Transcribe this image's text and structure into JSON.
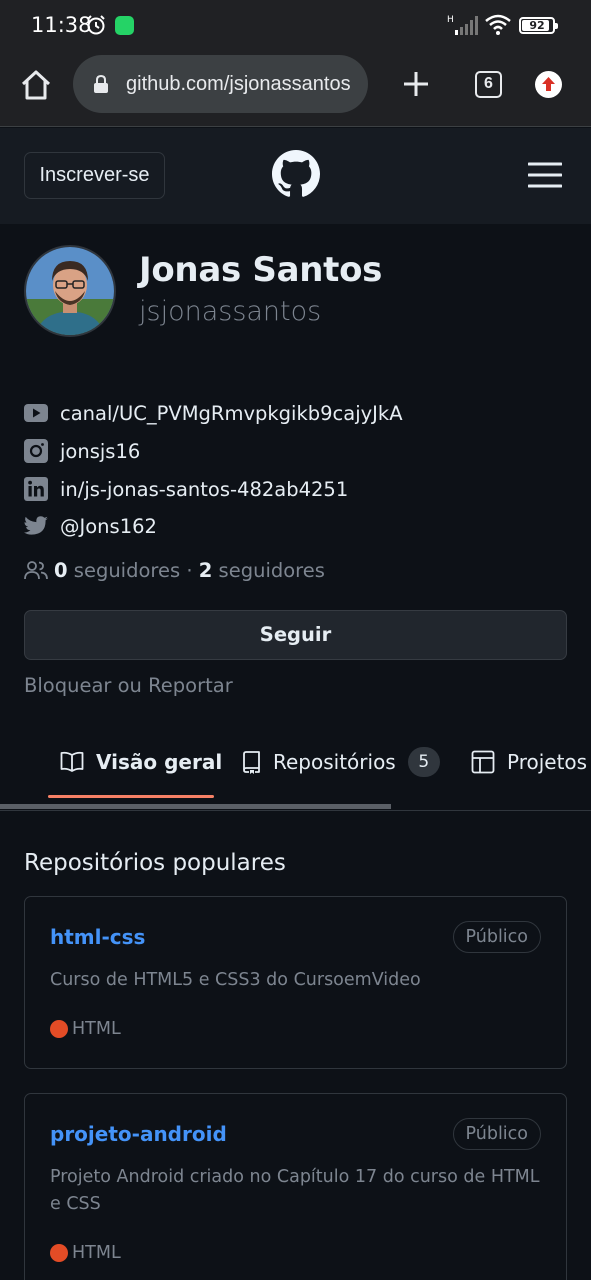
{
  "status_bar": {
    "time": "11:38",
    "network_label": "H",
    "battery_level": "92",
    "battery_fraction": 0.92
  },
  "browser": {
    "url": "github.com/jsjonassantos",
    "tab_count": "6",
    "icons": [
      "home-icon",
      "lock-icon",
      "plus-icon",
      "tabs-icon",
      "update-icon"
    ]
  },
  "header": {
    "signup_label": "Inscrever-se",
    "logo": "github-icon",
    "menu_icon": "hamburger-menu-icon"
  },
  "profile": {
    "display_name": "Jonas Santos",
    "username": "jsjonassantos",
    "social_links": [
      {
        "icon": "youtube-icon",
        "text": "canal/UC_PVMgRmvpkgikb9cajyJkA"
      },
      {
        "icon": "instagram-icon",
        "text": "jonsjs16"
      },
      {
        "icon": "linkedin-icon",
        "text": "in/js-jonas-santos-482ab4251"
      },
      {
        "icon": "twitter-icon",
        "text": "@Jons162"
      }
    ],
    "followers_count": "0",
    "followers_label": "seguidores",
    "separator": "·",
    "following_count": "2",
    "following_label": "seguidores",
    "follow_button": "Seguir",
    "block_link": "Bloquear ou Reportar"
  },
  "tabs": [
    {
      "label": "Visão geral",
      "icon": "book-icon",
      "active": true
    },
    {
      "label": "Repositórios",
      "icon": "repo-icon",
      "count": "5"
    },
    {
      "label": "Projetos",
      "icon": "table-icon"
    }
  ],
  "repos_section": {
    "title": "Repositórios populares",
    "repos": [
      {
        "name": "html-css",
        "badge": "Público",
        "description": "Curso de HTML5 e CSS3 do CursoemVideo",
        "language": "HTML",
        "language_color": "#e34c26"
      },
      {
        "name": "projeto-android",
        "badge": "Público",
        "description": "Projeto Android criado no Capítulo 17 do curso de HTML e CSS",
        "language": "HTML",
        "language_color": "#e34c26"
      }
    ]
  },
  "colors": {
    "background": "#0d1117",
    "header_bg": "#161b22",
    "link_blue": "#4493f8",
    "muted_text": "#7d8590",
    "active_tab_underline": "#f78166",
    "html_language": "#e34c26"
  }
}
